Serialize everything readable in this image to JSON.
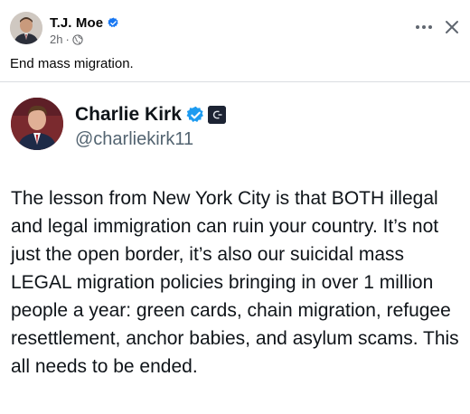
{
  "post": {
    "author_name": "T.J. Moe",
    "author_verified": true,
    "timestamp": "2h",
    "separator": "·",
    "audience_icon": "globe-icon",
    "text": "End mass migration.",
    "actions": {
      "more_icon": "more-horizontal-icon",
      "close_icon": "close-icon"
    }
  },
  "embedded_tweet": {
    "author_name": "Charlie Kirk",
    "verified": true,
    "affiliate_badge_icon": "affiliate-badge-icon",
    "handle": "@charliekirk11",
    "text": "The lesson from New York City is that BOTH illegal and legal immigration can ruin your country. It’s not just the open border, it’s also our suicidal mass LEGAL migration policies bringing in over 1 million people a year: green cards, chain migration, refugee resettlement, anchor babies, and asylum scams. This all needs to be ended."
  },
  "colors": {
    "verified_blue": "#1877f2",
    "twitter_verified_blue": "#1d9bf0",
    "primary_text": "#050505",
    "secondary_text": "#65676b",
    "handle_text": "#536471",
    "divider": "#dadde1"
  }
}
